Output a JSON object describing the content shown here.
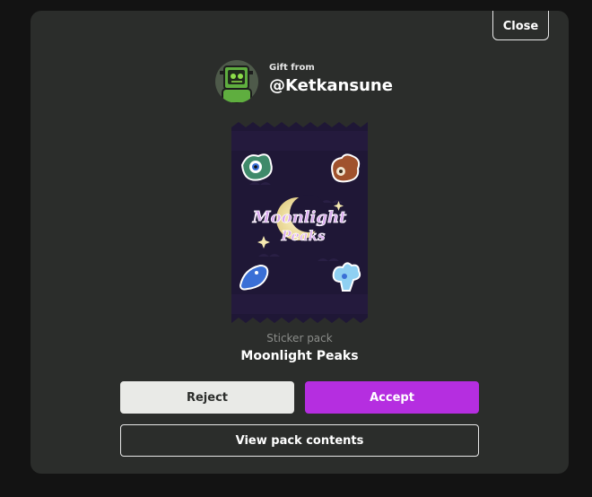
{
  "dialog": {
    "close_label": "Close",
    "gift_from_label": "Gift from",
    "gifter_name": "@Ketkansune",
    "pack_type": "Sticker pack",
    "pack_name": "Moonlight Peaks",
    "pack_logo_line1": "Moonlight",
    "pack_logo_line2": "Peaks",
    "reject_label": "Reject",
    "accept_label": "Accept",
    "view_contents_label": "View pack contents"
  },
  "colors": {
    "page_background": "#131313",
    "modal_background": "#2b2d2b",
    "accept_accent": "#b52ee0",
    "reject_background": "#e9eae7",
    "pack_background": "#1f1736"
  }
}
